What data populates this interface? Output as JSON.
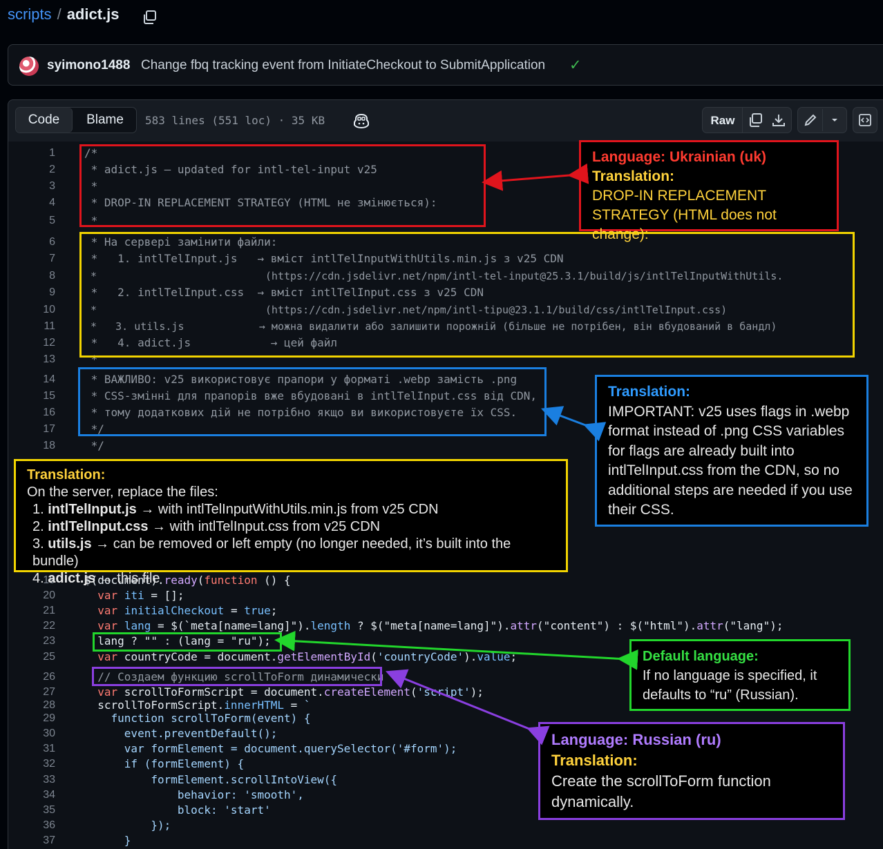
{
  "breadcrumb": {
    "repo": "scripts",
    "separator": "/",
    "file": "adict.js",
    "copy_icon": "copy-icon"
  },
  "commit": {
    "author": "syimono1488",
    "message": "Change fbq tracking event from InitiateCheckout to SubmitApplication",
    "status_icon": "check-icon",
    "status_color": "#3fb950"
  },
  "file_header": {
    "tabs": [
      "Code",
      "Blame"
    ],
    "active_tab": "Code",
    "info": "583 lines (551 loc) · 35 KB",
    "copilot_icon": "copilot-icon",
    "raw_label": "Raw",
    "icons": [
      "copy-icon",
      "download-icon",
      "pencil-icon",
      "chevron-down-icon",
      "symbols-icon"
    ]
  },
  "code_lines": [
    {
      "n": "1",
      "t": "/*"
    },
    {
      "n": "2",
      "t": " * adict.js — updated for intl-tel-input v25"
    },
    {
      "n": "3",
      "t": " *"
    },
    {
      "n": "4",
      "t": " * DROP-IN REPLACEMENT STRATEGY (HTML не змінюється):"
    },
    {
      "n": "5",
      "t": " *"
    },
    {
      "n": "6",
      "t": " * На сервері замінити файли:"
    },
    {
      "n": "7",
      "t": " *   1. intlTelInput.js   → вміст intlTelInputWithUtils.min.js з v25 CDN"
    },
    {
      "n": "8",
      "t": " *                           (https://cdn.jsdelivr.net/npm/intl-tel-input@25.3.1/build/js/intlTelInputWithUtils."
    },
    {
      "n": "9",
      "t": " *   2. intlTelInput.css  → вміст intlTelInput.css з v25 CDN"
    },
    {
      "n": "10",
      "t": " *                           (https://cdn.jsdelivr.net/npm/intl-tipu@23.1.1/build/css/intlTelInput.css)"
    },
    {
      "n": "11",
      "t": " *   3. utils.js            → можна видалити або залишити порожній (більше не потрібен, він вбудований в бандл)"
    },
    {
      "n": "12",
      "t": " *   4. adict.js            → цей файл"
    },
    {
      "n": "13",
      "t": " *"
    },
    {
      "n": "14",
      "t": " * ВАЖЛИВО: v25 використовує прапори у форматі .webp замість .png"
    },
    {
      "n": "15",
      "t": " * CSS-змінні для прапорів вже вбудовані в intlTelInput.css від CDN,"
    },
    {
      "n": "16",
      "t": " * тому додаткових дій не потрібно якщо ви використовуєте їх CSS."
    },
    {
      "n": "17",
      "t": " */"
    },
    {
      "n": "18",
      "t": " */"
    },
    {
      "n": "19",
      "t": "$(document).ready(function () {"
    },
    {
      "n": "20",
      "t": "  var iti = [];"
    },
    {
      "n": "21",
      "t": "  var initialCheckout = true;"
    },
    {
      "n": "22",
      "t": "  var lang = $(`meta[name=lang]\").length ? $(\"meta[name=lang]\").attr(\"content\") : $(\"html\").attr(\"lang\");"
    },
    {
      "n": "23",
      "t": "  lang ? \"\" : (lang = \"ru\");"
    },
    {
      "n": "25",
      "t": "  var countryCode = document.getElementById('countryCode').value;"
    },
    {
      "n": "26",
      "t": "  // Создаем функцию scrollToForm динамически"
    },
    {
      "n": "27",
      "t": "  var scrollToFormScript = document.createElement('script');"
    },
    {
      "n": "28",
      "t": "  scrollToFormScript.innerHTML = `"
    },
    {
      "n": "29",
      "t": "    function scrollToForm(event) {"
    },
    {
      "n": "30",
      "t": "      event.preventDefault();"
    },
    {
      "n": "31",
      "t": "      var formElement = document.querySelector('#form');"
    },
    {
      "n": "32",
      "t": "      if (formElement) {"
    },
    {
      "n": "33",
      "t": "          formElement.scrollIntoView({"
    },
    {
      "n": "34",
      "t": "              behavior: 'smooth',"
    },
    {
      "n": "35",
      "t": "              block: 'start'"
    },
    {
      "n": "36",
      "t": "          });"
    },
    {
      "n": "37",
      "t": "      }"
    }
  ],
  "annotations": {
    "ukrainian": {
      "heading": "Language: Ukrainian (uk)",
      "sub": "Translation:",
      "text": "DROP-IN REPLACEMENT STRATEGY (HTML does not change):",
      "color": "#e0141c"
    },
    "server_translation": {
      "heading": "Translation:",
      "intro": "On the server, replace the files:",
      "items": [
        {
          "num": "1.",
          "name": "intlTelInput.js",
          "rest": " → with intlTelInputWithUtils.min.js from v25 CDN"
        },
        {
          "num": "2.",
          "name": "intlTelInput.css",
          "rest": " → with intlTelInput.css from v25 CDN"
        },
        {
          "num": "3.",
          "name": "utils.js",
          "rest": " → can be removed or left empty (no longer needed, it’s built into the bundle)"
        },
        {
          "num": "4.",
          "name": "adict.js",
          "rest": " → this file"
        }
      ],
      "color": "#f2d400"
    },
    "important": {
      "heading": "Translation:",
      "text": "IMPORTANT: v25 uses flags in .webp format instead of .png CSS variables for flags are already built into intlTelInput.css from the CDN, so no additional steps are needed if you use their CSS.",
      "color": "#1a7fe0"
    },
    "default_lang": {
      "heading": "Default language:",
      "text": "If no language is specified, it defaults to “ru” (Russian).",
      "color": "#22d62c"
    },
    "russian": {
      "heading": "Language: Russian (ru)",
      "sub": "Translation:",
      "text": "Create the scrollToForm function dynamically.",
      "color": "#8a3fe0"
    }
  }
}
